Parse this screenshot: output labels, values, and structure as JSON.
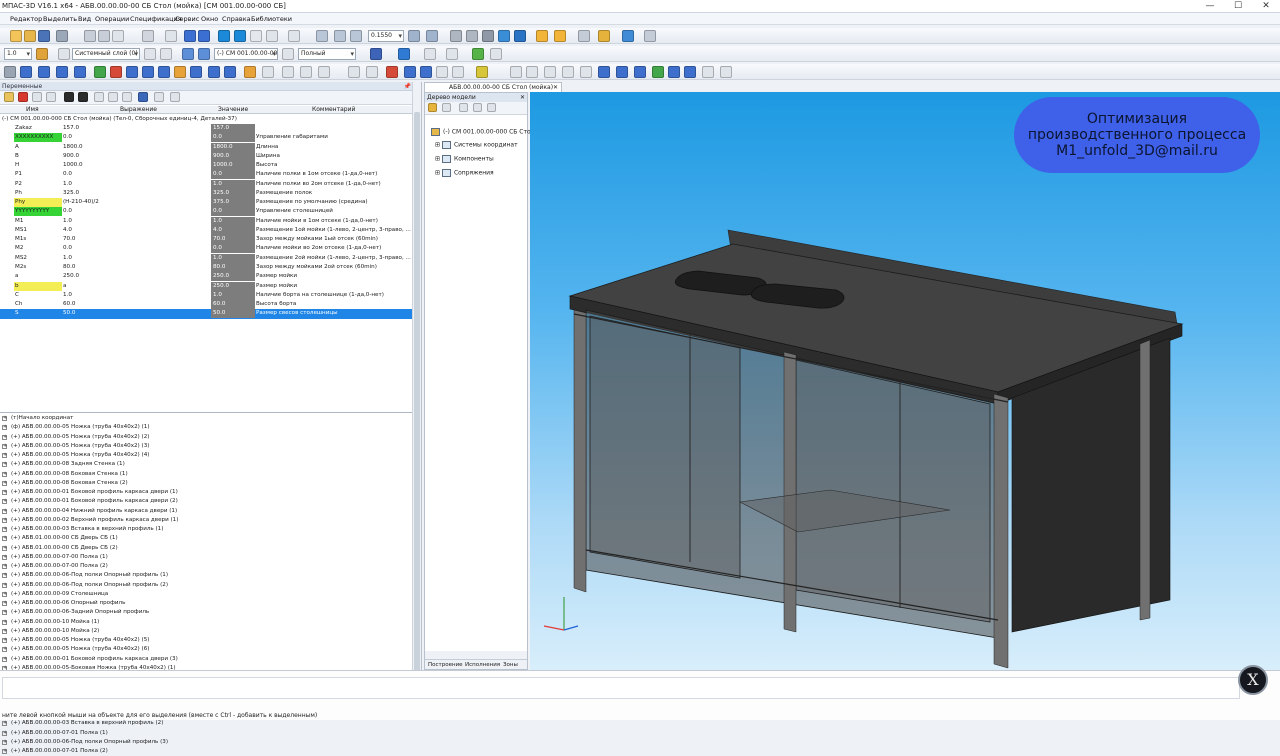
{
  "title": "МПАС-3D V16.1 x64 - АБВ.00.00.00-00 СБ Стол (мойка) [СМ 001.00.00-000 СБ]",
  "menu": [
    "Редактор",
    "Выделить",
    "Вид",
    "Операции",
    "Спецификация",
    "Сервис",
    "Окно",
    "Справка",
    "Библиотеки"
  ],
  "toolbar": {
    "zoom_value": "0.1550",
    "scale_value": "1.0",
    "layer_value": "Системный слой (0)",
    "doc_value": "(-) СМ 001.00.00-000",
    "mode_value": "Полный"
  },
  "vars_panel": {
    "title": "Переменные",
    "col_name": "Имя",
    "col_expr": "Выражение",
    "col_value": "Значение",
    "col_comment": "Комментарий",
    "root": "(-) СМ 001.00.00-000 СБ Стол (мойка) (Тел-0, Сборочных единиц-4, Деталей-37)",
    "rows": [
      {
        "name": "Zakaz",
        "expr": "157.0",
        "value": "157.0",
        "comment": "",
        "hl": ""
      },
      {
        "name": "XXXXXXXXXX",
        "expr": "0.0",
        "value": "0.0",
        "comment": "Управление габаритами",
        "hl": "#35d335"
      },
      {
        "name": "A",
        "expr": "1800.0",
        "value": "1800.0",
        "comment": "Длинна",
        "hl": ""
      },
      {
        "name": "B",
        "expr": "900.0",
        "value": "900.0",
        "comment": "Ширина",
        "hl": ""
      },
      {
        "name": "H",
        "expr": "1000.0",
        "value": "1000.0",
        "comment": "Высота",
        "hl": ""
      },
      {
        "name": "P1",
        "expr": "0.0",
        "value": "0.0",
        "comment": "Наличие полки в 1ом отсеке (1-да,0-нет)",
        "hl": ""
      },
      {
        "name": "P2",
        "expr": "1.0",
        "value": "1.0",
        "comment": "Наличие полки во 2ом отсеке (1-да,0-нет)",
        "hl": ""
      },
      {
        "name": "Ph",
        "expr": "325.0",
        "value": "325.0",
        "comment": "Размещение полок",
        "hl": ""
      },
      {
        "name": "Phy",
        "expr": "(H-210-40)/2",
        "value": "375.0",
        "comment": "Размещение по умолчанию (средина)",
        "hl": "#f3ee55"
      },
      {
        "name": "YYYYYYYYYY",
        "expr": "0.0",
        "value": "0.0",
        "comment": "Управление столешницей",
        "hl": "#35d335"
      },
      {
        "name": "M1",
        "expr": "1.0",
        "value": "1.0",
        "comment": "Наличие мойки в 1ом отсеке (1-да,0-нет)",
        "hl": ""
      },
      {
        "name": "MS1",
        "expr": "4.0",
        "value": "4.0",
        "comment": "Размещение 1ой мойки (1-лево, 2-центр, 3-право, ...",
        "hl": ""
      },
      {
        "name": "M1s",
        "expr": "70.0",
        "value": "70.0",
        "comment": "Зазор между мойками 1ый отсек (60min)",
        "hl": ""
      },
      {
        "name": "M2",
        "expr": "0.0",
        "value": "0.0",
        "comment": "Наличие мойки во 2ом отсеке (1-да,0-нет)",
        "hl": ""
      },
      {
        "name": "MS2",
        "expr": "1.0",
        "value": "1.0",
        "comment": "Размещение 2ой мойки (1-лево, 2-центр, 3-право, ...",
        "hl": ""
      },
      {
        "name": "M2s",
        "expr": "80.0",
        "value": "80.0",
        "comment": "Зазор между мойками 2ой отсек (60min)",
        "hl": ""
      },
      {
        "name": "a",
        "expr": "250.0",
        "value": "250.0",
        "comment": "Размер мойки",
        "hl": ""
      },
      {
        "name": "b",
        "expr": "a",
        "value": "250.0",
        "comment": "Размер мойки",
        "hl": "#f3ee55"
      },
      {
        "name": "C",
        "expr": "1.0",
        "value": "1.0",
        "comment": "Наличие борта на столешнице (1-да,0-нет)",
        "hl": ""
      },
      {
        "name": "Ch",
        "expr": "60.0",
        "value": "60.0",
        "comment": "Высота борта",
        "hl": ""
      },
      {
        "name": "S",
        "expr": "50.0",
        "value": "50.0",
        "comment": "Размер свесов столешницы",
        "hl": ""
      }
    ],
    "components": [
      "(т)Начало координат",
      "(ф) АБВ.00.00.00-05 Ножка (труба 40х40х2) (1)",
      "(+) АБВ.00.00.00-05 Ножка (труба 40х40х2) (2)",
      "(+) АБВ.00.00.00-05 Ножка (труба 40х40х2) (3)",
      "(+) АБВ.00.00.00-05 Ножка (труба 40х40х2) (4)",
      "(+) АБВ.00.00.00-08 Задняя Стенка (1)",
      "(+) АБВ.00.00.00-08 Боковая Стенка (1)",
      "(+) АБВ.00.00.00-08 Боковая Стенка (2)",
      "(+) АБВ.00.00.00-01 Боковой профиль каркаса двери (1)",
      "(+) АБВ.00.00.00-01 Боковой профиль каркаса двери (2)",
      "(+) АБВ.00.00.00-04 Нижний профиль каркаса двери (1)",
      "(+) АБВ.00.00.00-02 Верхний профиль каркаса двери (1)",
      "(+) АБВ.00.00.00-03 Вставка в верхний профиль (1)",
      "(+) АБВ.01.00.00-00 СБ Дверь СБ (1)",
      "(+) АБВ.01.00.00-00 СБ Дверь СБ (2)",
      "(+) АБВ.00.00.00-07-00 Полка (1)",
      "(+) АБВ.00.00.00-07-00 Полка (2)",
      "(+) АБВ.00.00.00-06-Под полки Опорный профиль (1)",
      "(+) АБВ.00.00.00-06-Под полки Опорный профиль (2)",
      "(+) АБВ.00.00.00-09 Столешница",
      "(+) АБВ.00.00.00-06 Опорный профиль",
      "(+) АБВ.00.00.00-06-Задний Опорный профиль",
      "(+) АБВ.00.00.00-10 Мойка (1)",
      "(+) АБВ.00.00.00-10 Мойка (2)",
      "(+) АБВ.00.00.00-05 Ножка (труба 40х40х2) (5)",
      "(+) АБВ.00.00.00-05 Ножка (труба 40х40х2) (6)",
      "(+) АБВ.00.00.00-01 Боковой профиль каркаса двери (3)",
      "(+) АБВ.00.00.00-05-Боковая Ножка (труба 40х40х2) (1)",
      "(+) АБВ.00.00.00-05-Боковая Ножка (труба 40х40х2) (2)",
      "(+) АБВ.00.00.00-08-Задняя Стенка (2)",
      "(+) АБВ.00.00.00-04 Нижний профиль каркаса двери (2)",
      "(+) АБВ.00.00.00-02 Верхний профиль каркаса двери (2)",
      "(+) АБВ.00.00.00-01 Боковой профиль каркаса двери (4)",
      "(+) АБВ.00.00.00-03 Вставка в верхний профиль (2)",
      "(+) АБВ.00.00.00-07-01 Полка (1)",
      "(+) АБВ.00.00.00-06-Под полки Опорный профиль (3)",
      "(+) АБВ.00.00.00-07-01 Полка (2)"
    ]
  },
  "model_tree": {
    "title": "Дерево модели",
    "doc_tab": "АБВ.00.00.00-00 СБ Стол (мойка)",
    "root": "(-) СМ 001.00.00-000 СБ Стол...",
    "nodes": [
      "Системы координат",
      "Компоненты",
      "Сопряжения"
    ],
    "tabs": [
      "Построение",
      "Исполнения",
      "Зоны"
    ]
  },
  "promo": {
    "line1": "Оптимизация",
    "line2": "производственного процесса",
    "line3": "M1_unfold_3D@mail.ru",
    "color": "#3f60e9"
  },
  "status": {
    "hint": "ните левой кнопкой мыши на объекте для его выделения (вместе с Ctrl - добавить к выделенным)"
  },
  "logo": {
    "glyph": "X"
  },
  "window_controls": {
    "minimize": "—",
    "maximize": "☐",
    "close": "✕"
  }
}
